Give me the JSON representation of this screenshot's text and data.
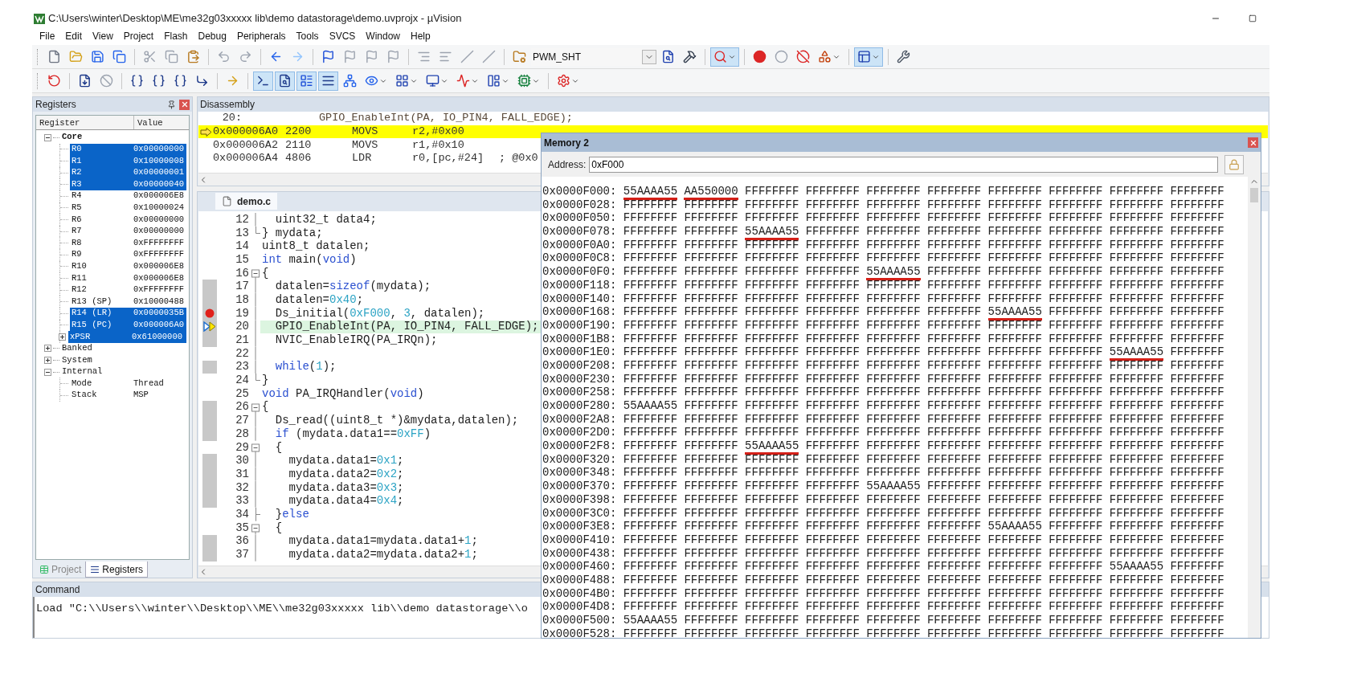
{
  "window": {
    "title": "C:\\Users\\winter\\Desktop\\ME\\me32g03xxxxx lib\\demo datastorage\\demo.uvprojx - µVision"
  },
  "menu": [
    "File",
    "Edit",
    "View",
    "Project",
    "Flash",
    "Debug",
    "Peripherals",
    "Tools",
    "SVCS",
    "Window",
    "Help"
  ],
  "toolbars": [
    {
      "items": [
        {
          "kind": "new-file",
          "pressed": false,
          "dropdown": false
        },
        {
          "kind": "open-file",
          "pressed": false,
          "dropdown": false
        },
        {
          "kind": "save",
          "pressed": false,
          "dropdown": false
        },
        {
          "kind": "save-all",
          "pressed": false,
          "dropdown": false
        },
        {
          "kind": "sep"
        },
        {
          "kind": "cut",
          "pressed": false,
          "dropdown": false
        },
        {
          "kind": "copy",
          "pressed": false,
          "dropdown": false
        },
        {
          "kind": "paste",
          "pressed": false,
          "dropdown": false
        },
        {
          "kind": "sep"
        },
        {
          "kind": "undo",
          "pressed": false,
          "dropdown": false
        },
        {
          "kind": "redo",
          "pressed": false,
          "dropdown": false
        },
        {
          "kind": "sep"
        },
        {
          "kind": "back",
          "pressed": false,
          "dropdown": false
        },
        {
          "kind": "forward",
          "pressed": false,
          "dropdown": false
        },
        {
          "kind": "sep"
        },
        {
          "kind": "bookmark",
          "pressed": false,
          "dropdown": false
        },
        {
          "kind": "bookmark-prev",
          "pressed": false,
          "dropdown": false
        },
        {
          "kind": "bookmark-next",
          "pressed": false,
          "dropdown": false
        },
        {
          "kind": "bookmark-clear",
          "pressed": false,
          "dropdown": false
        },
        {
          "kind": "sep"
        },
        {
          "kind": "indent",
          "pressed": false,
          "dropdown": false
        },
        {
          "kind": "outdent",
          "pressed": false,
          "dropdown": false
        },
        {
          "kind": "comment",
          "pressed": false,
          "dropdown": false
        },
        {
          "kind": "uncomment",
          "pressed": false,
          "dropdown": false
        },
        {
          "kind": "sep"
        },
        {
          "kind": "target-options",
          "pressed": false,
          "dropdown": false
        },
        {
          "kind": "select",
          "value": "PWM_SHT"
        },
        {
          "kind": "find",
          "pressed": false,
          "dropdown": false
        },
        {
          "kind": "configure",
          "pressed": false,
          "dropdown": false
        },
        {
          "kind": "sep"
        },
        {
          "kind": "debug",
          "pressed": true,
          "dropdown": true
        },
        {
          "kind": "sep"
        },
        {
          "kind": "breakpoint",
          "pressed": false,
          "dropdown": false
        },
        {
          "kind": "breakpoint-enable",
          "pressed": false,
          "dropdown": false
        },
        {
          "kind": "breakpoint-disable",
          "pressed": false,
          "dropdown": false
        },
        {
          "kind": "breakpoint-kill",
          "pressed": false,
          "dropdown": true
        },
        {
          "kind": "sep"
        },
        {
          "kind": "windows",
          "pressed": true,
          "dropdown": true
        },
        {
          "kind": "sep"
        },
        {
          "kind": "settings",
          "pressed": false,
          "dropdown": false
        }
      ]
    },
    {
      "items": [
        {
          "kind": "reset",
          "pressed": false,
          "dropdown": false
        },
        {
          "kind": "sep"
        },
        {
          "kind": "run",
          "pressed": false,
          "dropdown": false
        },
        {
          "kind": "stop",
          "pressed": false,
          "dropdown": false
        },
        {
          "kind": "sep"
        },
        {
          "kind": "step-into",
          "pressed": false,
          "dropdown": false
        },
        {
          "kind": "step-over",
          "pressed": false,
          "dropdown": false
        },
        {
          "kind": "step-out",
          "pressed": false,
          "dropdown": false
        },
        {
          "kind": "run-to-cursor",
          "pressed": false,
          "dropdown": false
        },
        {
          "kind": "sep"
        },
        {
          "kind": "show-next",
          "pressed": false,
          "dropdown": false
        },
        {
          "kind": "sep"
        },
        {
          "kind": "command-window",
          "pressed": true,
          "dropdown": false
        },
        {
          "kind": "disassembly-window",
          "pressed": true,
          "dropdown": false
        },
        {
          "kind": "symbols-window",
          "pressed": true,
          "dropdown": false
        },
        {
          "kind": "registers-window",
          "pressed": true,
          "dropdown": false
        },
        {
          "kind": "call-stack",
          "pressed": false,
          "dropdown": false
        },
        {
          "kind": "watch",
          "pressed": false,
          "dropdown": true
        },
        {
          "kind": "memory",
          "pressed": false,
          "dropdown": true
        },
        {
          "kind": "serial",
          "pressed": false,
          "dropdown": true
        },
        {
          "kind": "analysis",
          "pressed": false,
          "dropdown": true
        },
        {
          "kind": "trace",
          "pressed": false,
          "dropdown": true
        },
        {
          "kind": "system-viewer",
          "pressed": false,
          "dropdown": true
        },
        {
          "kind": "sep"
        },
        {
          "kind": "toolbox",
          "pressed": false,
          "dropdown": true
        }
      ]
    }
  ],
  "registers": {
    "title": "Registers",
    "columns": [
      "Register",
      "Value"
    ],
    "tree": [
      {
        "name": "Core",
        "emphasized": true,
        "expanded": true,
        "selected": false,
        "children": [
          {
            "name": "R0",
            "value": "0x00000000",
            "selected": true
          },
          {
            "name": "R1",
            "value": "0x10000008",
            "selected": true
          },
          {
            "name": "R2",
            "value": "0x00000001",
            "selected": true
          },
          {
            "name": "R3",
            "value": "0x00000040",
            "selected": true
          },
          {
            "name": "R4",
            "value": "0x000006E8",
            "selected": false
          },
          {
            "name": "R5",
            "value": "0x10000024",
            "selected": false
          },
          {
            "name": "R6",
            "value": "0x00000000",
            "selected": false
          },
          {
            "name": "R7",
            "value": "0x00000000",
            "selected": false
          },
          {
            "name": "R8",
            "value": "0xFFFFFFFF",
            "selected": false
          },
          {
            "name": "R9",
            "value": "0xFFFFFFFF",
            "selected": false
          },
          {
            "name": "R10",
            "value": "0x000006E8",
            "selected": false
          },
          {
            "name": "R11",
            "value": "0x000006E8",
            "selected": false
          },
          {
            "name": "R12",
            "value": "0xFFFFFFFF",
            "selected": false
          },
          {
            "name": "R13 (SP)",
            "value": "0x10000488",
            "selected": false
          },
          {
            "name": "R14 (LR)",
            "value": "0x0000035B",
            "selected": true
          },
          {
            "name": "R15 (PC)",
            "value": "0x000006A0",
            "selected": true
          },
          {
            "name": "xPSR",
            "value": "0x61000000",
            "selected": true,
            "expanded": false
          }
        ]
      },
      {
        "name": "Banked",
        "emphasized": false,
        "expanded": false,
        "selected": false
      },
      {
        "name": "System",
        "emphasized": false,
        "expanded": false,
        "selected": false
      },
      {
        "name": "Internal",
        "emphasized": false,
        "expanded": true,
        "selected": false,
        "children": [
          {
            "name": "Mode",
            "value": "Thread",
            "selected": false
          },
          {
            "name": "Stack",
            "value": "MSP",
            "selected": false
          }
        ]
      }
    ],
    "tabs": [
      {
        "label": "Project",
        "selected": false
      },
      {
        "label": "Registers",
        "selected": true
      }
    ]
  },
  "disassembly": {
    "title": "Disassembly",
    "source_line": "20:",
    "source_text": "GPIO_EnableInt(PA, IO_PIN4, FALL_EDGE);",
    "rows": [
      {
        "address": "0x000006A0",
        "opcode": "2200",
        "mnemonic": "MOVS",
        "operands": "r2,#0x00",
        "current": true
      },
      {
        "address": "0x000006A2",
        "opcode": "2110",
        "mnemonic": "MOVS",
        "operands": "r1,#0x10",
        "current": false
      },
      {
        "address": "0x000006A4",
        "opcode": "4806",
        "mnemonic": "LDR",
        "operands": "r0,[pc,#24]",
        "comment": "; @0x0",
        "current": false
      }
    ]
  },
  "editor": {
    "tab": {
      "label": "demo.c",
      "selected": true
    },
    "lines": [
      {
        "number": "12",
        "fold": {
          "kind": "inside"
        },
        "executable": false,
        "breakpoint": false,
        "current": false,
        "tokens": [
          {
            "kind": "plain",
            "text": "  uint32_t data4;"
          }
        ]
      },
      {
        "number": "13",
        "fold": {
          "kind": "end"
        },
        "executable": false,
        "breakpoint": false,
        "current": false,
        "tokens": [
          {
            "kind": "plain",
            "text": "} mydata;"
          }
        ]
      },
      {
        "number": "14",
        "fold": {
          "kind": "none"
        },
        "executable": false,
        "breakpoint": false,
        "current": false,
        "tokens": [
          {
            "kind": "plain",
            "text": "uint8_t datalen;"
          }
        ]
      },
      {
        "number": "15",
        "fold": {
          "kind": "none"
        },
        "executable": false,
        "breakpoint": false,
        "current": false,
        "tokens": [
          {
            "kind": "keyword",
            "text": "int"
          },
          {
            "kind": "plain",
            "text": " main("
          },
          {
            "kind": "keyword",
            "text": "void"
          },
          {
            "kind": "plain",
            "text": ")"
          }
        ]
      },
      {
        "number": "16",
        "fold": {
          "kind": "start"
        },
        "executable": false,
        "breakpoint": false,
        "current": false,
        "tokens": [
          {
            "kind": "plain",
            "text": "{"
          }
        ]
      },
      {
        "number": "17",
        "fold": {
          "kind": "inside"
        },
        "executable": true,
        "breakpoint": false,
        "current": false,
        "tokens": [
          {
            "kind": "plain",
            "text": "  datalen="
          },
          {
            "kind": "keyword",
            "text": "sizeof"
          },
          {
            "kind": "plain",
            "text": "(mydata);"
          }
        ]
      },
      {
        "number": "18",
        "fold": {
          "kind": "inside"
        },
        "executable": true,
        "breakpoint": false,
        "current": false,
        "tokens": [
          {
            "kind": "plain",
            "text": "  datalen="
          },
          {
            "kind": "number",
            "text": "0x40"
          },
          {
            "kind": "plain",
            "text": ";"
          }
        ]
      },
      {
        "number": "19",
        "fold": {
          "kind": "inside"
        },
        "executable": true,
        "breakpoint": true,
        "current": false,
        "tokens": [
          {
            "kind": "plain",
            "text": "  Ds_initial("
          },
          {
            "kind": "number",
            "text": "0xF000"
          },
          {
            "kind": "plain",
            "text": ", "
          },
          {
            "kind": "number",
            "text": "3"
          },
          {
            "kind": "plain",
            "text": ", datalen);"
          }
        ]
      },
      {
        "number": "20",
        "fold": {
          "kind": "inside"
        },
        "executable": true,
        "breakpoint": false,
        "current": true,
        "tokens": [
          {
            "kind": "plain",
            "text": "  GPIO_EnableInt(PA, IO_PIN4, FALL_EDGE);"
          }
        ]
      },
      {
        "number": "21",
        "fold": {
          "kind": "inside"
        },
        "executable": true,
        "breakpoint": false,
        "current": false,
        "tokens": [
          {
            "kind": "plain",
            "text": "  NVIC_EnableIRQ(PA_IRQn);"
          }
        ]
      },
      {
        "number": "22",
        "fold": {
          "kind": "inside"
        },
        "executable": false,
        "breakpoint": false,
        "current": false
      },
      {
        "number": "23",
        "fold": {
          "kind": "inside"
        },
        "executable": true,
        "breakpoint": false,
        "current": false,
        "tokens": [
          {
            "kind": "keyword",
            "text": "  while"
          },
          {
            "kind": "plain",
            "text": "("
          },
          {
            "kind": "number",
            "text": "1"
          },
          {
            "kind": "plain",
            "text": ");"
          }
        ]
      },
      {
        "number": "24",
        "fold": {
          "kind": "end"
        },
        "executable": false,
        "breakpoint": false,
        "current": false,
        "tokens": [
          {
            "kind": "plain",
            "text": "}"
          }
        ]
      },
      {
        "number": "25",
        "fold": {
          "kind": "none"
        },
        "executable": false,
        "breakpoint": false,
        "current": false,
        "tokens": [
          {
            "kind": "keyword",
            "text": "void"
          },
          {
            "kind": "plain",
            "text": " PA_IRQHandler("
          },
          {
            "kind": "keyword",
            "text": "void"
          },
          {
            "kind": "plain",
            "text": ")"
          }
        ]
      },
      {
        "number": "26",
        "fold": {
          "kind": "start"
        },
        "executable": true,
        "breakpoint": false,
        "current": false,
        "tokens": [
          {
            "kind": "plain",
            "text": "{"
          }
        ]
      },
      {
        "number": "27",
        "fold": {
          "kind": "inside"
        },
        "executable": true,
        "breakpoint": false,
        "current": false,
        "tokens": [
          {
            "kind": "plain",
            "text": "  Ds_read((uint8_t *)&mydata,datalen);"
          }
        ]
      },
      {
        "number": "28",
        "fold": {
          "kind": "inside"
        },
        "executable": true,
        "breakpoint": false,
        "current": false,
        "tokens": [
          {
            "kind": "keyword",
            "text": "  if"
          },
          {
            "kind": "plain",
            "text": " (mydata.data1=="
          },
          {
            "kind": "number",
            "text": "0xFF"
          },
          {
            "kind": "plain",
            "text": ")"
          }
        ]
      },
      {
        "number": "29",
        "fold": {
          "kind": "start"
        },
        "executable": false,
        "breakpoint": false,
        "current": false,
        "tokens": [
          {
            "kind": "plain",
            "text": "  {"
          }
        ]
      },
      {
        "number": "30",
        "fold": {
          "kind": "inside"
        },
        "executable": true,
        "breakpoint": false,
        "current": false,
        "tokens": [
          {
            "kind": "plain",
            "text": "    mydata.data1="
          },
          {
            "kind": "number",
            "text": "0x1"
          },
          {
            "kind": "plain",
            "text": ";"
          }
        ]
      },
      {
        "number": "31",
        "fold": {
          "kind": "inside"
        },
        "executable": true,
        "breakpoint": false,
        "current": false,
        "tokens": [
          {
            "kind": "plain",
            "text": "    mydata.data2="
          },
          {
            "kind": "number",
            "text": "0x2"
          },
          {
            "kind": "plain",
            "text": ";"
          }
        ]
      },
      {
        "number": "32",
        "fold": {
          "kind": "inside"
        },
        "executable": true,
        "breakpoint": false,
        "current": false,
        "tokens": [
          {
            "kind": "plain",
            "text": "    mydata.data3="
          },
          {
            "kind": "number",
            "text": "0x3"
          },
          {
            "kind": "plain",
            "text": ";"
          }
        ]
      },
      {
        "number": "33",
        "fold": {
          "kind": "inside"
        },
        "executable": true,
        "breakpoint": false,
        "current": false,
        "tokens": [
          {
            "kind": "plain",
            "text": "    mydata.data4="
          },
          {
            "kind": "number",
            "text": "0x4"
          },
          {
            "kind": "plain",
            "text": ";"
          }
        ]
      },
      {
        "number": "34",
        "fold": {
          "kind": "branch"
        },
        "executable": false,
        "breakpoint": false,
        "current": false,
        "tokens": [
          {
            "kind": "plain",
            "text": "  }"
          },
          {
            "kind": "keyword",
            "text": "else"
          }
        ]
      },
      {
        "number": "35",
        "fold": {
          "kind": "start"
        },
        "executable": false,
        "breakpoint": false,
        "current": false,
        "tokens": [
          {
            "kind": "plain",
            "text": "  {"
          }
        ]
      },
      {
        "number": "36",
        "fold": {
          "kind": "inside"
        },
        "executable": true,
        "breakpoint": false,
        "current": false,
        "tokens": [
          {
            "kind": "plain",
            "text": "    mydata.data1=mydata.data1+"
          },
          {
            "kind": "number",
            "text": "1"
          },
          {
            "kind": "plain",
            "text": ";"
          }
        ]
      },
      {
        "number": "37",
        "fold": {
          "kind": "inside"
        },
        "executable": true,
        "breakpoint": false,
        "current": false,
        "tokens": [
          {
            "kind": "plain",
            "text": "    mydata.data2=mydata.data2+"
          },
          {
            "kind": "number",
            "text": "1"
          },
          {
            "kind": "plain",
            "text": ";"
          }
        ]
      }
    ]
  },
  "memory": {
    "title": "Memory 2",
    "address_label": "Address:",
    "address": "0xF000",
    "rows": [
      {
        "address": "0x0000F000:",
        "words": [
          {
            "text": "55AAAA55",
            "underlined": true
          },
          {
            "text": "AA550000",
            "underlined": true
          },
          "FFFFFFFF",
          "FFFFFFFF",
          "FFFFFFFF",
          "FFFFFFFF",
          "FFFFFFFF",
          "FFFFFFFF",
          "FFFFFFFF",
          "FFFFFFFF"
        ]
      },
      {
        "address": "0x0000F028:",
        "words": [
          "FFFFFFFF",
          "FFFFFFFF",
          "FFFFFFFF",
          "FFFFFFFF",
          "FFFFFFFF",
          "FFFFFFFF",
          "FFFFFFFF",
          "FFFFFFFF",
          "FFFFFFFF",
          "FFFFFFFF"
        ]
      },
      {
        "address": "0x0000F050:",
        "words": [
          "FFFFFFFF",
          "FFFFFFFF",
          "FFFFFFFF",
          "FFFFFFFF",
          "FFFFFFFF",
          "FFFFFFFF",
          "FFFFFFFF",
          "FFFFFFFF",
          "FFFFFFFF",
          "FFFFFFFF"
        ]
      },
      {
        "address": "0x0000F078:",
        "words": [
          "FFFFFFFF",
          "FFFFFFFF",
          {
            "text": "55AAAA55",
            "underlined": true
          },
          "FFFFFFFF",
          "FFFFFFFF",
          "FFFFFFFF",
          "FFFFFFFF",
          "FFFFFFFF",
          "FFFFFFFF",
          "FFFFFFFF"
        ]
      },
      {
        "address": "0x0000F0A0:",
        "words": [
          "FFFFFFFF",
          "FFFFFFFF",
          "FFFFFFFF",
          "FFFFFFFF",
          "FFFFFFFF",
          "FFFFFFFF",
          "FFFFFFFF",
          "FFFFFFFF",
          "FFFFFFFF",
          "FFFFFFFF"
        ]
      },
      {
        "address": "0x0000F0C8:",
        "words": [
          "FFFFFFFF",
          "FFFFFFFF",
          "FFFFFFFF",
          "FFFFFFFF",
          "FFFFFFFF",
          "FFFFFFFF",
          "FFFFFFFF",
          "FFFFFFFF",
          "FFFFFFFF",
          "FFFFFFFF"
        ]
      },
      {
        "address": "0x0000F0F0:",
        "words": [
          "FFFFFFFF",
          "FFFFFFFF",
          "FFFFFFFF",
          "FFFFFFFF",
          {
            "text": "55AAAA55",
            "underlined": true
          },
          "FFFFFFFF",
          "FFFFFFFF",
          "FFFFFFFF",
          "FFFFFFFF",
          "FFFFFFFF"
        ]
      },
      {
        "address": "0x0000F118:",
        "words": [
          "FFFFFFFF",
          "FFFFFFFF",
          "FFFFFFFF",
          "FFFFFFFF",
          "FFFFFFFF",
          "FFFFFFFF",
          "FFFFFFFF",
          "FFFFFFFF",
          "FFFFFFFF",
          "FFFFFFFF"
        ]
      },
      {
        "address": "0x0000F140:",
        "words": [
          "FFFFFFFF",
          "FFFFFFFF",
          "FFFFFFFF",
          "FFFFFFFF",
          "FFFFFFFF",
          "FFFFFFFF",
          "FFFFFFFF",
          "FFFFFFFF",
          "FFFFFFFF",
          "FFFFFFFF"
        ]
      },
      {
        "address": "0x0000F168:",
        "words": [
          "FFFFFFFF",
          "FFFFFFFF",
          "FFFFFFFF",
          "FFFFFFFF",
          "FFFFFFFF",
          "FFFFFFFF",
          {
            "text": "55AAAA55",
            "underlined": true
          },
          "FFFFFFFF",
          "FFFFFFFF",
          "FFFFFFFF"
        ]
      },
      {
        "address": "0x0000F190:",
        "words": [
          "FFFFFFFF",
          "FFFFFFFF",
          "FFFFFFFF",
          "FFFFFFFF",
          "FFFFFFFF",
          "FFFFFFFF",
          "FFFFFFFF",
          "FFFFFFFF",
          "FFFFFFFF",
          "FFFFFFFF"
        ]
      },
      {
        "address": "0x0000F1B8:",
        "words": [
          "FFFFFFFF",
          "FFFFFFFF",
          "FFFFFFFF",
          "FFFFFFFF",
          "FFFFFFFF",
          "FFFFFFFF",
          "FFFFFFFF",
          "FFFFFFFF",
          "FFFFFFFF",
          "FFFFFFFF"
        ]
      },
      {
        "address": "0x0000F1E0:",
        "words": [
          "FFFFFFFF",
          "FFFFFFFF",
          "FFFFFFFF",
          "FFFFFFFF",
          "FFFFFFFF",
          "FFFFFFFF",
          "FFFFFFFF",
          "FFFFFFFF",
          {
            "text": "55AAAA55",
            "underlined": true
          },
          "FFFFFFFF"
        ]
      },
      {
        "address": "0x0000F208:",
        "words": [
          "FFFFFFFF",
          "FFFFFFFF",
          "FFFFFFFF",
          "FFFFFFFF",
          "FFFFFFFF",
          "FFFFFFFF",
          "FFFFFFFF",
          "FFFFFFFF",
          "FFFFFFFF",
          "FFFFFFFF"
        ]
      },
      {
        "address": "0x0000F230:",
        "words": [
          "FFFFFFFF",
          "FFFFFFFF",
          "FFFFFFFF",
          "FFFFFFFF",
          "FFFFFFFF",
          "FFFFFFFF",
          "FFFFFFFF",
          "FFFFFFFF",
          "FFFFFFFF",
          "FFFFFFFF"
        ]
      },
      {
        "address": "0x0000F258:",
        "words": [
          "FFFFFFFF",
          "FFFFFFFF",
          "FFFFFFFF",
          "FFFFFFFF",
          "FFFFFFFF",
          "FFFFFFFF",
          "FFFFFFFF",
          "FFFFFFFF",
          "FFFFFFFF",
          "FFFFFFFF"
        ]
      },
      {
        "address": "0x0000F280:",
        "words": [
          {
            "text": "55AAAA55",
            "underlined": false
          },
          "FFFFFFFF",
          "FFFFFFFF",
          "FFFFFFFF",
          "FFFFFFFF",
          "FFFFFFFF",
          "FFFFFFFF",
          "FFFFFFFF",
          "FFFFFFFF",
          "FFFFFFFF"
        ]
      },
      {
        "address": "0x0000F2A8:",
        "words": [
          "FFFFFFFF",
          "FFFFFFFF",
          "FFFFFFFF",
          "FFFFFFFF",
          "FFFFFFFF",
          "FFFFFFFF",
          "FFFFFFFF",
          "FFFFFFFF",
          "FFFFFFFF",
          "FFFFFFFF"
        ]
      },
      {
        "address": "0x0000F2D0:",
        "words": [
          "FFFFFFFF",
          "FFFFFFFF",
          "FFFFFFFF",
          "FFFFFFFF",
          "FFFFFFFF",
          "FFFFFFFF",
          "FFFFFFFF",
          "FFFFFFFF",
          "FFFFFFFF",
          "FFFFFFFF"
        ]
      },
      {
        "address": "0x0000F2F8:",
        "words": [
          "FFFFFFFF",
          "FFFFFFFF",
          {
            "text": "55AAAA55",
            "underlined": true
          },
          "FFFFFFFF",
          "FFFFFFFF",
          "FFFFFFFF",
          "FFFFFFFF",
          "FFFFFFFF",
          "FFFFFFFF",
          "FFFFFFFF"
        ]
      },
      {
        "address": "0x0000F320:",
        "words": [
          "FFFFFFFF",
          "FFFFFFFF",
          "FFFFFFFF",
          "FFFFFFFF",
          "FFFFFFFF",
          "FFFFFFFF",
          "FFFFFFFF",
          "FFFFFFFF",
          "FFFFFFFF",
          "FFFFFFFF"
        ]
      },
      {
        "address": "0x0000F348:",
        "words": [
          "FFFFFFFF",
          "FFFFFFFF",
          "FFFFFFFF",
          "FFFFFFFF",
          "FFFFFFFF",
          "FFFFFFFF",
          "FFFFFFFF",
          "FFFFFFFF",
          "FFFFFFFF",
          "FFFFFFFF"
        ]
      },
      {
        "address": "0x0000F370:",
        "words": [
          "FFFFFFFF",
          "FFFFFFFF",
          "FFFFFFFF",
          "FFFFFFFF",
          {
            "text": "55AAAA55",
            "underlined": false
          },
          "FFFFFFFF",
          "FFFFFFFF",
          "FFFFFFFF",
          "FFFFFFFF",
          "FFFFFFFF"
        ]
      },
      {
        "address": "0x0000F398:",
        "words": [
          "FFFFFFFF",
          "FFFFFFFF",
          "FFFFFFFF",
          "FFFFFFFF",
          "FFFFFFFF",
          "FFFFFFFF",
          "FFFFFFFF",
          "FFFFFFFF",
          "FFFFFFFF",
          "FFFFFFFF"
        ]
      },
      {
        "address": "0x0000F3C0:",
        "words": [
          "FFFFFFFF",
          "FFFFFFFF",
          "FFFFFFFF",
          "FFFFFFFF",
          "FFFFFFFF",
          "FFFFFFFF",
          "FFFFFFFF",
          "FFFFFFFF",
          "FFFFFFFF",
          "FFFFFFFF"
        ]
      },
      {
        "address": "0x0000F3E8:",
        "words": [
          "FFFFFFFF",
          "FFFFFFFF",
          "FFFFFFFF",
          "FFFFFFFF",
          "FFFFFFFF",
          "FFFFFFFF",
          {
            "text": "55AAAA55",
            "underlined": false
          },
          "FFFFFFFF",
          "FFFFFFFF",
          "FFFFFFFF"
        ]
      },
      {
        "address": "0x0000F410:",
        "words": [
          "FFFFFFFF",
          "FFFFFFFF",
          "FFFFFFFF",
          "FFFFFFFF",
          "FFFFFFFF",
          "FFFFFFFF",
          "FFFFFFFF",
          "FFFFFFFF",
          "FFFFFFFF",
          "FFFFFFFF"
        ]
      },
      {
        "address": "0x0000F438:",
        "words": [
          "FFFFFFFF",
          "FFFFFFFF",
          "FFFFFFFF",
          "FFFFFFFF",
          "FFFFFFFF",
          "FFFFFFFF",
          "FFFFFFFF",
          "FFFFFFFF",
          "FFFFFFFF",
          "FFFFFFFF"
        ]
      },
      {
        "address": "0x0000F460:",
        "words": [
          "FFFFFFFF",
          "FFFFFFFF",
          "FFFFFFFF",
          "FFFFFFFF",
          "FFFFFFFF",
          "FFFFFFFF",
          "FFFFFFFF",
          "FFFFFFFF",
          {
            "text": "55AAAA55",
            "underlined": false
          },
          "FFFFFFFF"
        ]
      },
      {
        "address": "0x0000F488:",
        "words": [
          "FFFFFFFF",
          "FFFFFFFF",
          "FFFFFFFF",
          "FFFFFFFF",
          "FFFFFFFF",
          "FFFFFFFF",
          "FFFFFFFF",
          "FFFFFFFF",
          "FFFFFFFF",
          "FFFFFFFF"
        ]
      },
      {
        "address": "0x0000F4B0:",
        "words": [
          "FFFFFFFF",
          "FFFFFFFF",
          "FFFFFFFF",
          "FFFFFFFF",
          "FFFFFFFF",
          "FFFFFFFF",
          "FFFFFFFF",
          "FFFFFFFF",
          "FFFFFFFF",
          "FFFFFFFF"
        ]
      },
      {
        "address": "0x0000F4D8:",
        "words": [
          "FFFFFFFF",
          "FFFFFFFF",
          "FFFFFFFF",
          "FFFFFFFF",
          "FFFFFFFF",
          "FFFFFFFF",
          "FFFFFFFF",
          "FFFFFFFF",
          "FFFFFFFF",
          "FFFFFFFF"
        ]
      },
      {
        "address": "0x0000F500:",
        "words": [
          {
            "text": "55AAAA55",
            "underlined": false
          },
          "FFFFFFFF",
          "FFFFFFFF",
          "FFFFFFFF",
          "FFFFFFFF",
          "FFFFFFFF",
          "FFFFFFFF",
          "FFFFFFFF",
          "FFFFFFFF",
          "FFFFFFFF"
        ]
      },
      {
        "address": "0x0000F528:",
        "words": [
          "FFFFFFFF",
          "FFFFFFFF",
          "FFFFFFFF",
          "FFFFFFFF",
          "FFFFFFFF",
          "FFFFFFFF",
          "FFFFFFFF",
          "FFFFFFFF",
          "FFFFFFFF",
          "FFFFFFFF"
        ]
      }
    ]
  },
  "command": {
    "title": "Command",
    "text": "Load \"C:\\\\Users\\\\winter\\\\Desktop\\\\ME\\\\me32g03xxxxx lib\\\\demo datastorage\\\\o"
  }
}
